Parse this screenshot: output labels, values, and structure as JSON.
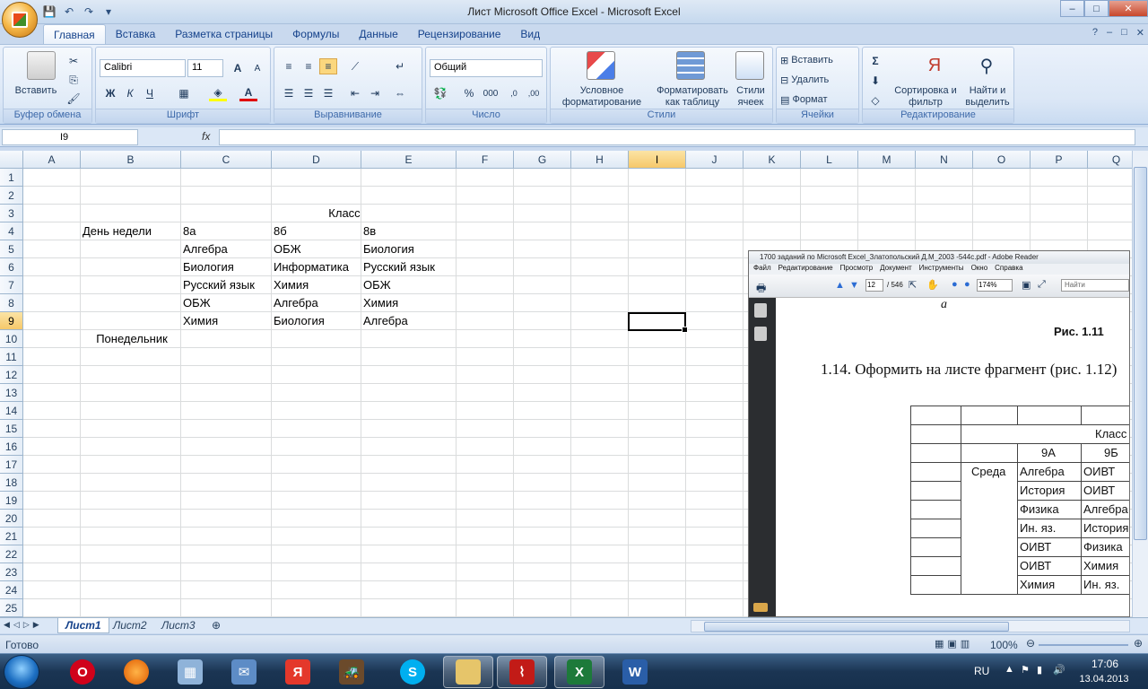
{
  "window": {
    "title": "Лист Microsoft Office Excel - Microsoft Excel",
    "controls": [
      "–",
      "□",
      "✕"
    ]
  },
  "ribbon_tabs": [
    "Главная",
    "Вставка",
    "Разметка страницы",
    "Формулы",
    "Данные",
    "Рецензирование",
    "Вид"
  ],
  "active_tab": "Главная",
  "groups": {
    "clipboard": {
      "label": "Буфер обмена",
      "paste": "Вставить"
    },
    "font": {
      "label": "Шрифт",
      "font_name": "Calibri",
      "font_size": "11",
      "bold": "Ж",
      "italic": "К",
      "underline": "Ч"
    },
    "alignment": {
      "label": "Выравнивание"
    },
    "number": {
      "label": "Число",
      "format": "Общий",
      "percent": "%",
      "thousands": "000"
    },
    "styles": {
      "label": "Стили",
      "conditional": "Условное форматирование",
      "format_table": "Форматировать как таблицу",
      "cell_styles": "Стили ячеек"
    },
    "cells": {
      "label": "Ячейки",
      "insert": "Вставить",
      "delete": "Удалить",
      "format": "Формат"
    },
    "editing": {
      "label": "Редактирование",
      "sort": "Сортировка и фильтр",
      "find": "Найти и выделить"
    }
  },
  "formula_bar": {
    "name_box": "I9",
    "fx": "fx",
    "formula": ""
  },
  "columns": [
    "A",
    "B",
    "C",
    "D",
    "E",
    "F",
    "G",
    "H",
    "I",
    "J",
    "K",
    "L",
    "M",
    "N",
    "O",
    "P",
    "Q"
  ],
  "selected_column": "I",
  "rows": [
    "1",
    "2",
    "3",
    "4",
    "5",
    "6",
    "7",
    "8",
    "9",
    "10",
    "11",
    "12",
    "13",
    "14",
    "15",
    "16",
    "17",
    "18",
    "19",
    "20",
    "21",
    "22",
    "23",
    "24",
    "25"
  ],
  "selected_row": "9",
  "cells": {
    "D3": "Класс",
    "B4": "День недели",
    "C4": "8а",
    "D4": "8б",
    "E4": "8в",
    "C5": "Алгебра",
    "D5": "ОБЖ",
    "E5": "Биология",
    "C6": "Биология",
    "D6": "Информатика",
    "E6": "Русский язык",
    "C7": "Русский язык",
    "D7": "Химия",
    "E7": "ОБЖ",
    "C8": "ОБЖ",
    "D8": "Алгебра",
    "E8": "Химия",
    "C9": "Химия",
    "D9": "Биология",
    "E9": "Алгебра",
    "B10": "Понедельник"
  },
  "sheet_tabs": [
    "Лист1",
    "Лист2",
    "Лист3"
  ],
  "active_sheet": "Лист1",
  "status": {
    "text": "Готово",
    "zoom": "100%"
  },
  "pdf": {
    "title": "1700 заданий по Microsoft Excel_Златопольский Д.М_2003 -544с.pdf - Adobe Reader",
    "menu": [
      "Файл",
      "Редактирование",
      "Просмотр",
      "Документ",
      "Инструменты",
      "Окно",
      "Справка"
    ],
    "page": "12",
    "pages": "/ 546",
    "zoom": "174%",
    "find": "Найти",
    "letter_a": "а",
    "fig_caption": "Рис. 1.11",
    "task": "1.14. Оформить на листе фрагмент (рис. 1.12)",
    "table": {
      "class": "Класс",
      "col_9a": "9А",
      "col_9b": "9Б",
      "day": "Среда",
      "c1": [
        "Алгебра",
        "История",
        "Физика",
        "Ин. яз.",
        "ОИВТ",
        "ОИВТ",
        "Химия"
      ],
      "c2": [
        "ОИВТ",
        "ОИВТ",
        "Алгебра",
        "История",
        "Физика",
        "Химия",
        "Ин. яз."
      ]
    }
  },
  "tray": {
    "lang": "RU",
    "time": "17:06",
    "date": "13.04.2013"
  }
}
